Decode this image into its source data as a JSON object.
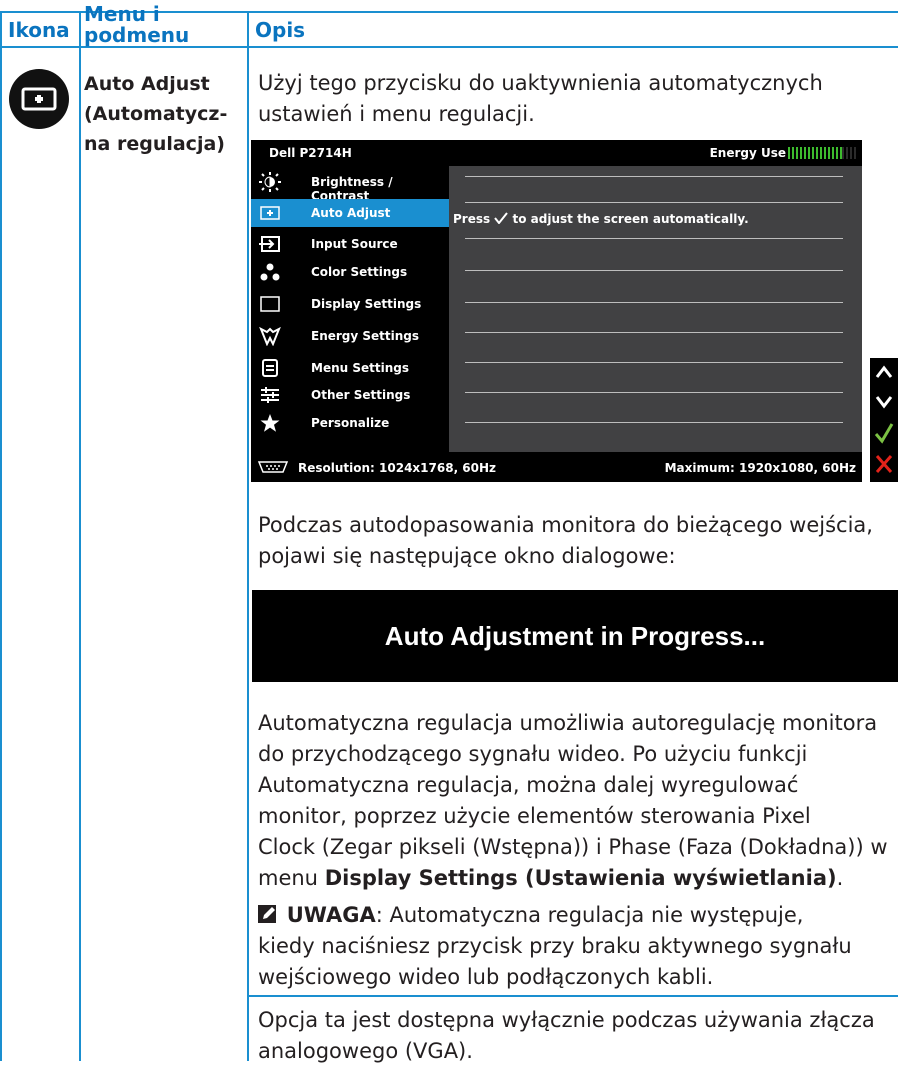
{
  "header": {
    "col1": "Ikona",
    "col2_line1": "Menu i",
    "col2_line2": "podmenu",
    "col3": "Opis"
  },
  "row": {
    "icon": "auto-adjust-icon",
    "menu_line1": "Auto Adjust",
    "menu_line2": "(Automatycz-",
    "menu_line3": "na regulacja)",
    "intro_line1": "Użyj tego przycisku do uaktywnienia automatycznych",
    "intro_line2": "ustawień i menu regulacji."
  },
  "osd": {
    "title": "Dell P2714H",
    "energy_label": "Energy Use",
    "menu_items": [
      {
        "label": "Brightness / Contrast",
        "icon": "brightness-icon"
      },
      {
        "label": "Auto Adjust",
        "icon": "auto-adjust-icon",
        "selected": true
      },
      {
        "label": "Input Source",
        "icon": "input-source-icon"
      },
      {
        "label": "Color Settings",
        "icon": "color-settings-icon"
      },
      {
        "label": "Display Settings",
        "icon": "display-settings-icon"
      },
      {
        "label": "Energy Settings",
        "icon": "energy-settings-icon"
      },
      {
        "label": "Menu Settings",
        "icon": "menu-settings-icon"
      },
      {
        "label": "Other Settings",
        "icon": "other-settings-icon"
      },
      {
        "label": "Personalize",
        "icon": "star-icon"
      }
    ],
    "message_prefix": "Press",
    "message_suffix": "to adjust the screen automatically.",
    "resolution": "Resolution: 1024x1768, 60Hz",
    "maximum": "Maximum: 1920x1080, 60Hz",
    "side_buttons": [
      "up-arrow-icon",
      "down-arrow-icon",
      "check-icon",
      "close-icon"
    ],
    "colors": {
      "selected": "#1a8fd0",
      "panel": "#414143",
      "meter": "#3dbb2e",
      "check": "#7bc143",
      "close": "#e2231a"
    }
  },
  "body": {
    "para1_line1": "Podczas autodopasowania monitora do bieżącego wejścia,",
    "para1_line2": "pojawi się następujące okno dialogowe:",
    "banner": "Auto Adjustment in Progress...",
    "para2_line1": "Automatyczna regulacja umożliwia autoregulację monitora",
    "para2_line2": "do przychodzącego sygnału wideo. Po użyciu funkcji",
    "para2_line3": "Automatyczna regulacja, można dalej wyregulować",
    "para2_line4": "monitor, poprzez użycie elementów sterowania Pixel",
    "para2_line5": "Clock (Zegar pikseli (Wstępna)) i Phase (Faza (Dokładna)) w",
    "para2_line6_prefix": "menu",
    "para2_line6_bold": "Display Settings (Ustawienia wyświetlania)",
    "para2_line6_suffix": ".",
    "note_label": "UWAGA",
    "note_line1_rest": ": Automatyczna regulacja nie występuje,",
    "note_line2": "kiedy naciśniesz przycisk przy braku aktywnego sygnału",
    "note_line3": "wejściowego wideo lub podłączonych kabli.",
    "para3_line1": "Opcja ta jest dostępna wyłącznie podczas używania złącza",
    "para3_line2": "analogowego (VGA)."
  },
  "colors": {
    "accent": "#0a74bf",
    "border": "#1a8fd0",
    "text": "#231f20"
  }
}
